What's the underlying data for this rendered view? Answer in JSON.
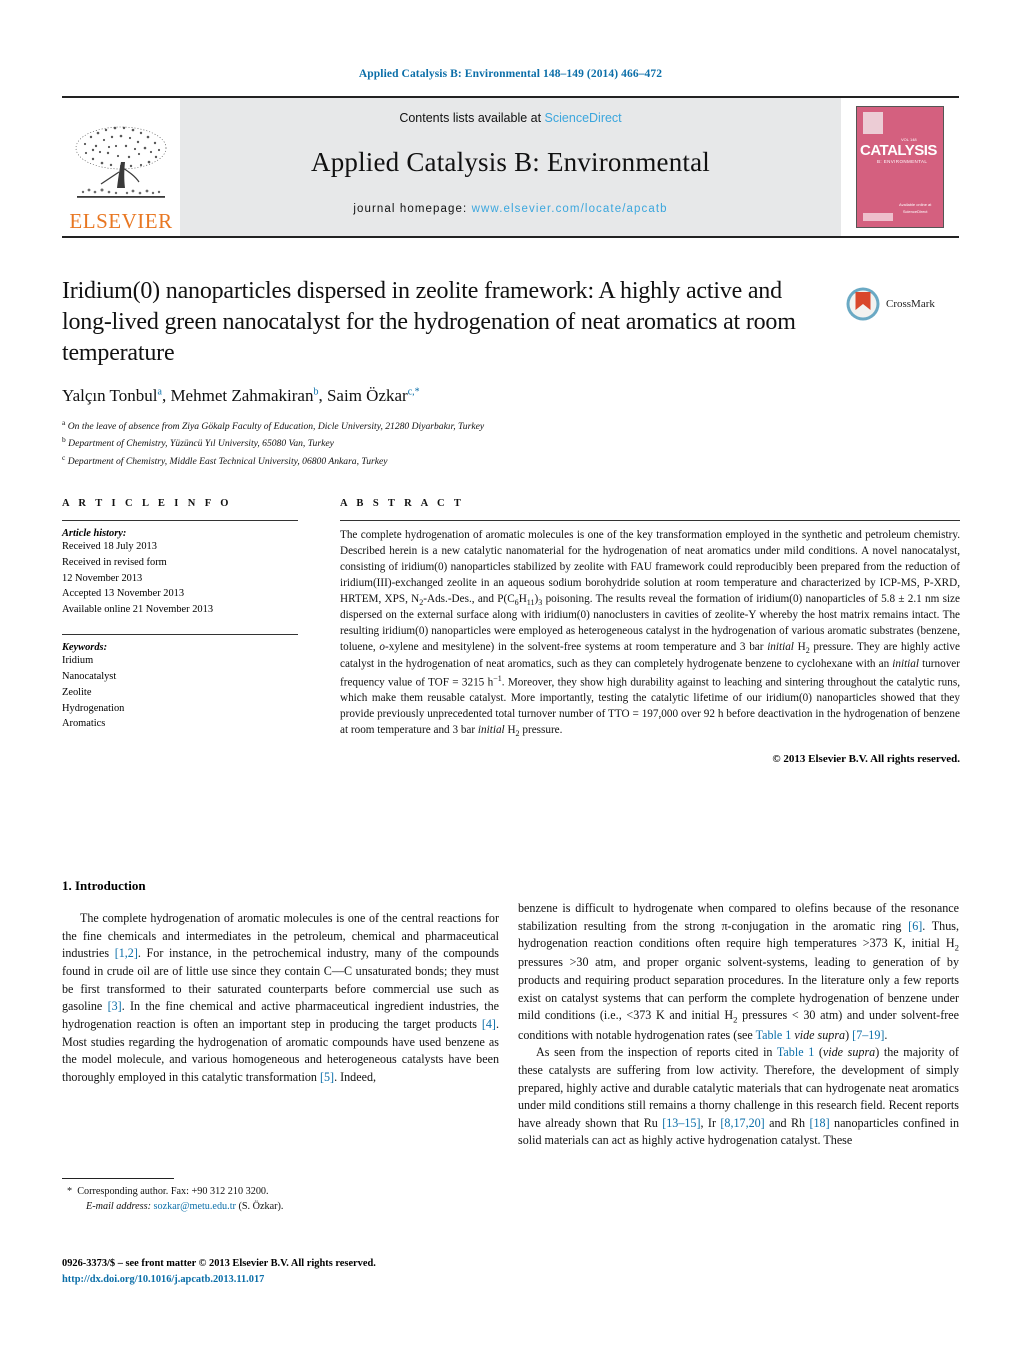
{
  "running_head": "Applied Catalysis B: Environmental 148–149 (2014) 466–472",
  "masthead": {
    "contents_prefix": "Contents lists available at ",
    "sciencedirect": "ScienceDirect",
    "journal_title": "Applied Catalysis B: Environmental",
    "homepage_prefix": "journal homepage: ",
    "homepage_url": "www.elsevier.com/locate/apcatb",
    "publisher": "ELSEVIER",
    "cover": {
      "main": "CATALYSIS",
      "sub": "B: ENVIRONMENTAL",
      "tiny": "VOL 148",
      "bottom": "Available online at\nScienceDirect\nwww.sciencedirect.com"
    },
    "accent_link_color": "#3ba6dd",
    "band_color": "#e7e8e9",
    "elsevier_orange": "#E87722"
  },
  "article": {
    "title": "Iridium(0) nanoparticles dispersed in zeolite framework: A highly active and long-lived green nanocatalyst for the hydrogenation of neat aromatics at room temperature",
    "authors": [
      {
        "name": "Yalçın Tonbul",
        "marks": "a"
      },
      {
        "name": "Mehmet Zahmakiran",
        "marks": "b"
      },
      {
        "name": "Saim Özkar",
        "marks": "c,*"
      }
    ],
    "affiliations": [
      {
        "mark": "a",
        "text": "On the leave of absence from Ziya Gökalp Faculty of Education, Dicle University, 21280 Diyarbakır, Turkey"
      },
      {
        "mark": "b",
        "text": "Department of Chemistry, Yüzüncü Yıl University, 65080 Van, Turkey"
      },
      {
        "mark": "c",
        "text": "Department of Chemistry, Middle East Technical University, 06800 Ankara, Turkey"
      }
    ],
    "crossmark_label": "CrossMark"
  },
  "article_info": {
    "heading": "A R T I C L E    I N F O",
    "history_title": "Article history:",
    "history": [
      "Received 18 July 2013",
      "Received in revised form",
      "12 November 2013",
      "Accepted 13 November 2013",
      "Available online 21 November 2013"
    ],
    "keywords_title": "Keywords:",
    "keywords": [
      "Iridium",
      "Nanocatalyst",
      "Zeolite",
      "Hydrogenation",
      "Aromatics"
    ]
  },
  "abstract": {
    "heading": "A B S T R A C T",
    "paragraph_1": "The complete hydrogenation of aromatic molecules is one of the key transformation employed in the synthetic and petroleum chemistry. Described herein is a new catalytic nanomaterial for the hydrogenation of neat aromatics under mild conditions. A novel nanocatalyst, consisting of iridium(0) nanoparticles stabilized by zeolite with FAU framework could reproducibly been prepared from the reduction of iridium(III)-exchanged zeolite in an aqueous sodium borohydride solution at room temperature and characterized by ICP-MS, P-XRD, HRTEM, XPS, N",
    "frag_2": "-Ads.-Des., and P(C",
    "frag_3": "H",
    "frag_4": ")",
    "frag_5": " poisoning. The results reveal the formation of iridium(0) nanoparticles of 5.8 ± 2.1 nm size dispersed on the external surface along with iridium(0) nanoclusters in cavities of zeolite-Y whereby the host matrix remains intact. The resulting iridium(0) nanoparticles were employed as heterogeneous catalyst in the hydrogenation of various aromatic substrates (benzene, toluene, ",
    "ital_oxylene": "o",
    "frag_6": "-xylene and mesitylene) in the solvent-free systems at room temperature and 3 bar ",
    "ital_initial_1": "initial",
    "frag_7": " H",
    "frag_8": " pressure. They are highly active catalyst in the hydrogenation of neat aromatics, such as they can completely hydrogenate benzene to cyclohexane with an ",
    "ital_initial_2": "initial",
    "frag_9": " turnover frequency value of TOF = 3215 h",
    "sup_minus1": "−1",
    "frag_10": ". Moreover, they show high durability against to leaching and sintering throughout the catalytic runs, which make them reusable catalyst. More importantly, testing the catalytic lifetime of our iridium(0) nanoparticles showed that they provide previously unprecedented total turnover number of TTO = 197,000 over 92 h before deactivation in the hydrogenation of benzene at room temperature and 3 bar ",
    "ital_initial_3": "initial",
    "frag_11": " H",
    "frag_12": " pressure.",
    "copyright": "© 2013 Elsevier B.V. All rights reserved."
  },
  "body": {
    "section_number_title": "1.  Introduction",
    "left_p1_a": "The complete hydrogenation of aromatic molecules is one of the central reactions for the fine chemicals and intermediates in the petroleum, chemical and pharmaceutical industries ",
    "left_ref_12": "[1,2]",
    "left_p1_b": ". For instance, in the petrochemical industry, many of the compounds found in crude oil are of little use since they contain C",
    "left_p1_cc": "C unsaturated bonds; they must be first transformed to their saturated counterparts before commercial use such as gasoline ",
    "left_ref_3": "[3]",
    "left_p1_c": ". In the fine chemical and active pharmaceutical ingredient industries, the hydrogenation reaction is often an important step in producing the target products ",
    "left_ref_4": "[4]",
    "left_p1_d": ". Most studies regarding the hydrogenation of aromatic compounds have used benzene as the model molecule, and various homogeneous and heterogeneous catalysts have been thoroughly employed in this catalytic transformation ",
    "left_ref_5": "[5]",
    "left_p1_e": ". Indeed,",
    "right_p1_a": "benzene is difficult to hydrogenate when compared to olefins because of the resonance stabilization resulting from the strong π-conjugation in the aromatic ring ",
    "right_ref_6": "[6]",
    "right_p1_b": ". Thus, hydrogenation reaction conditions often require high temperatures >373 K, initial H",
    "right_p1_c": " pressures >30 atm, and proper organic solvent-systems, leading to generation of by products and requiring product separation procedures. In the literature only a few reports exist on catalyst systems that can perform the complete hydrogenation of benzene under mild conditions (i.e., <373 K and initial H",
    "right_p1_d": " pressures < 30 atm) and under solvent-free conditions with notable hydrogenation rates (see ",
    "right_table1_a": "Table 1",
    "right_p1_e": " ",
    "right_vide_supra_a": "vide supra",
    "right_p1_f": ") ",
    "right_ref_719": "[7–19]",
    "right_p1_g": ".",
    "right_p2_a": "As seen from the inspection of reports cited in ",
    "right_table1_b": "Table 1",
    "right_p2_b": " (",
    "right_vide_supra_b": "vide supra",
    "right_p2_c": ") the majority of these catalysts are suffering from low activity. Therefore, the development of simply prepared, highly active and durable catalytic materials that can hydrogenate neat aromatics under mild conditions still remains a thorny challenge in this research field. Recent reports have already shown that Ru ",
    "right_ref_1315": "[13–15]",
    "right_p2_d": ", Ir ",
    "right_ref_81720": "[8,17,20]",
    "right_p2_e": " and Rh ",
    "right_ref_18": "[18]",
    "right_p2_f": " nanoparticles confined in solid materials can act as highly active hydrogenation catalyst. These"
  },
  "footnote": {
    "star": "*",
    "corresponding": "Corresponding author. Fax: +90 312 210 3200.",
    "email_label": "E-mail address:",
    "email": "sozkar@metu.edu.tr",
    "email_suffix": "(S. Özkar).",
    "imprint": "0926-3373/$ – see front matter © 2013 Elsevier B.V. All rights reserved.",
    "doi": "http://dx.doi.org/10.1016/j.apcatb.2013.11.017"
  },
  "colors": {
    "link_blue": "#0b6ea8",
    "sd_blue": "#3ba6dd",
    "elsevier_orange": "#E87722",
    "cover_pink": "#d4607f"
  }
}
